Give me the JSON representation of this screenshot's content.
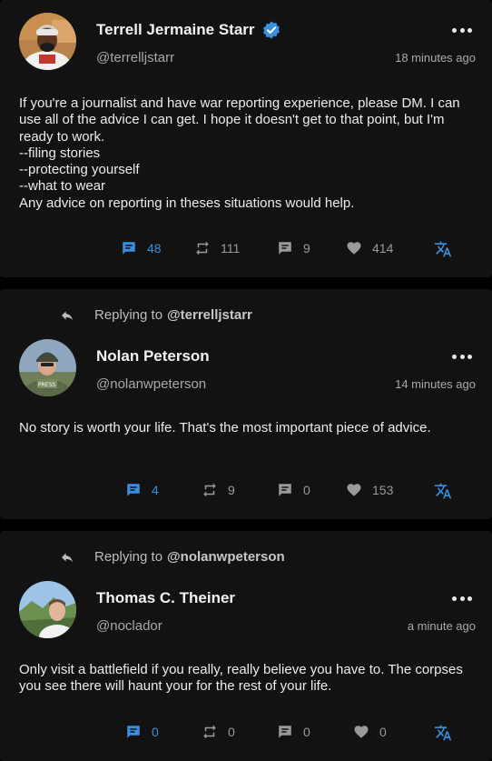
{
  "posts": [
    {
      "author": {
        "name": "Terrell Jermaine Starr",
        "handle": "@terrelljstarr",
        "verified": true
      },
      "time": "18 minutes ago",
      "text": "If you're a journalist and have war reporting experience, please DM. I can use all of the advice I can get. I hope it doesn't get to that point, but I'm ready to work.\n--filing stories\n--protecting yourself\n--what to wear\nAny advice on reporting in theses situations would help.",
      "counts": {
        "comments": "48",
        "reposts": "111",
        "replies": "9",
        "likes": "414"
      }
    },
    {
      "reply_to": {
        "prefix": "Replying to",
        "handle": "@terrelljstarr"
      },
      "author": {
        "name": "Nolan Peterson",
        "handle": "@nolanwpeterson",
        "verified": false
      },
      "time": "14 minutes ago",
      "text": "No story is worth your life. That's the most important piece of advice.",
      "counts": {
        "comments": "4",
        "reposts": "9",
        "replies": "0",
        "likes": "153"
      }
    },
    {
      "reply_to": {
        "prefix": "Replying to",
        "handle": "@nolanwpeterson"
      },
      "author": {
        "name": "Thomas C. Theiner",
        "handle": "@noclador",
        "verified": false
      },
      "time": "a minute ago",
      "text": "Only visit a battlefield if you really, really believe you have to. The corpses you see there will haunt your for the rest of your life.",
      "counts": {
        "comments": "0",
        "reposts": "0",
        "replies": "0",
        "likes": "0"
      }
    }
  ],
  "colors": {
    "accent": "#3b8fe0",
    "card": "#121212",
    "background": "#000000"
  },
  "icons": [
    "verified-badge-icon",
    "more-options-icon",
    "reply-arrow-icon",
    "comment-icon",
    "repost-icon",
    "reply-count-icon",
    "heart-icon",
    "translate-icon"
  ]
}
